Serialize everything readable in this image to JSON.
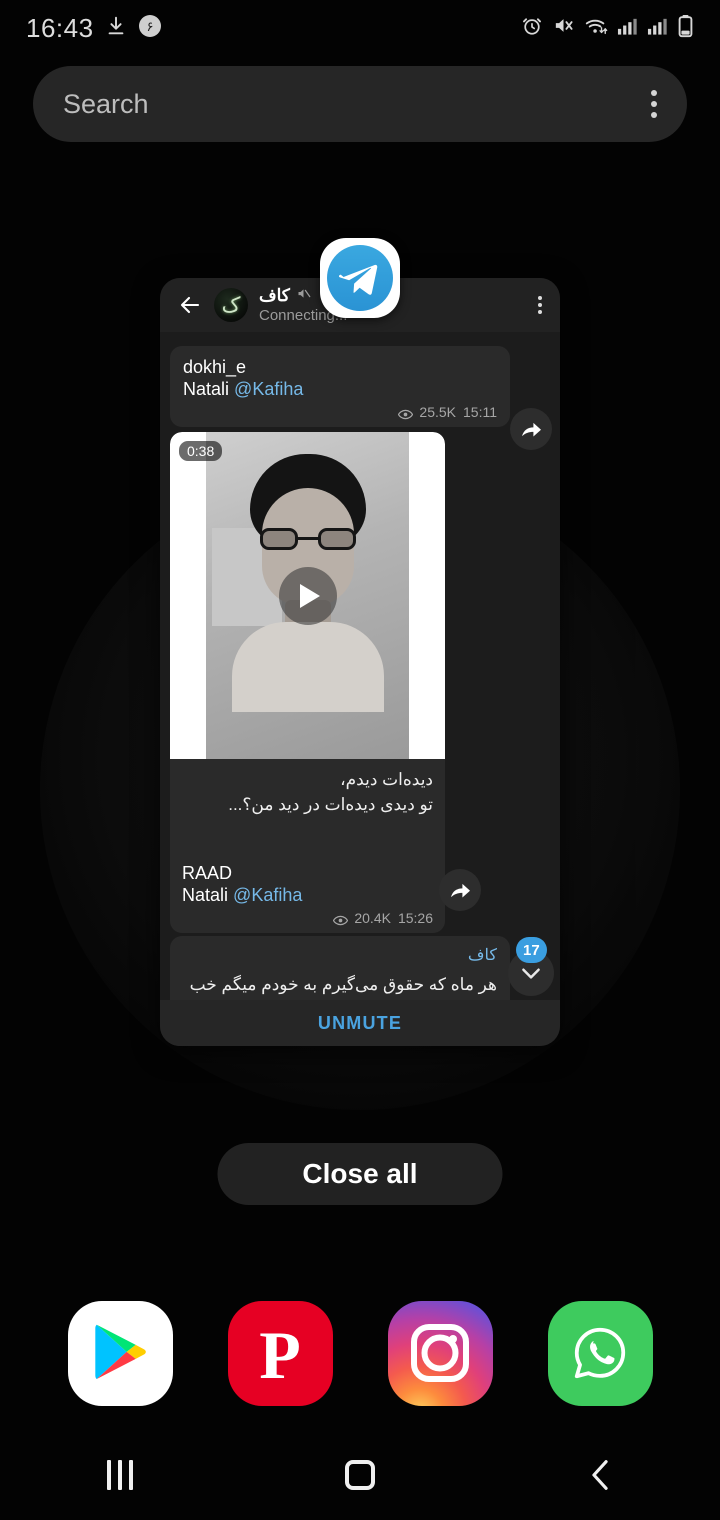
{
  "status_bar": {
    "time": "16:43",
    "icons_left": [
      "download-icon",
      "persian-badge-icon"
    ],
    "badge_text": "۶",
    "icons_right": [
      "alarm-icon",
      "mute-icon",
      "wifi-icon",
      "signal-icon",
      "signal-icon",
      "battery-icon"
    ]
  },
  "search": {
    "placeholder": "Search",
    "menu_icon": "overflow-menu-icon"
  },
  "recents_card": {
    "app_icon": "telegram-icon",
    "chat_header": {
      "back_icon": "back-arrow-icon",
      "avatar": "channel-avatar",
      "avatar_glyph": "ک",
      "title": "کاف",
      "mute_icon": "muted-speaker-icon",
      "subtitle": "Connecting...",
      "menu_icon": "overflow-menu-icon"
    },
    "messages": [
      {
        "name": "dokhi_e",
        "channel": "Natali",
        "handle": "@Kafiha",
        "views": "25.5K",
        "time": "15:11",
        "forward_icon": "forward-arrow-icon"
      },
      {
        "video_duration": "0:38",
        "play_icon": "play-icon",
        "menu_icon": "overflow-menu-icon",
        "caption_line1": "دیده‌ات دیدم،",
        "caption_line2": "تو دیدی دیده‌ات در دید من؟...",
        "name": "RAAD",
        "channel": "Natali",
        "handle": "@Kafiha",
        "views": "20.4K",
        "time": "15:26",
        "forward_icon": "forward-arrow-icon"
      },
      {
        "channel": "کاف",
        "body": "هر ماه که حقوق می‌گیرم به خودم میگم خب تا همین‌جا بسه دیگه، واسه چس تومن حقوق کار نکن بابا خاک عالم بر سرت."
      }
    ],
    "unread_badge": "17",
    "scroll_down_icon": "chevron-down-icon",
    "unmute_label": "UNMUTE",
    "accent_blue": "#4aa3e0"
  },
  "close_all": {
    "label": "Close all"
  },
  "dock": {
    "apps": [
      {
        "name": "play-store",
        "label": "Play Store",
        "color": "#ffffff"
      },
      {
        "name": "pinterest",
        "label": "Pinterest",
        "color": "#e60023",
        "glyph": "P"
      },
      {
        "name": "instagram",
        "label": "Instagram",
        "color": "#e0407a"
      },
      {
        "name": "whatsapp",
        "label": "WhatsApp",
        "color": "#3ecb5e"
      }
    ]
  },
  "nav_bar": {
    "recents_icon": "recents-icon",
    "home_icon": "home-icon",
    "back_icon": "back-icon"
  }
}
